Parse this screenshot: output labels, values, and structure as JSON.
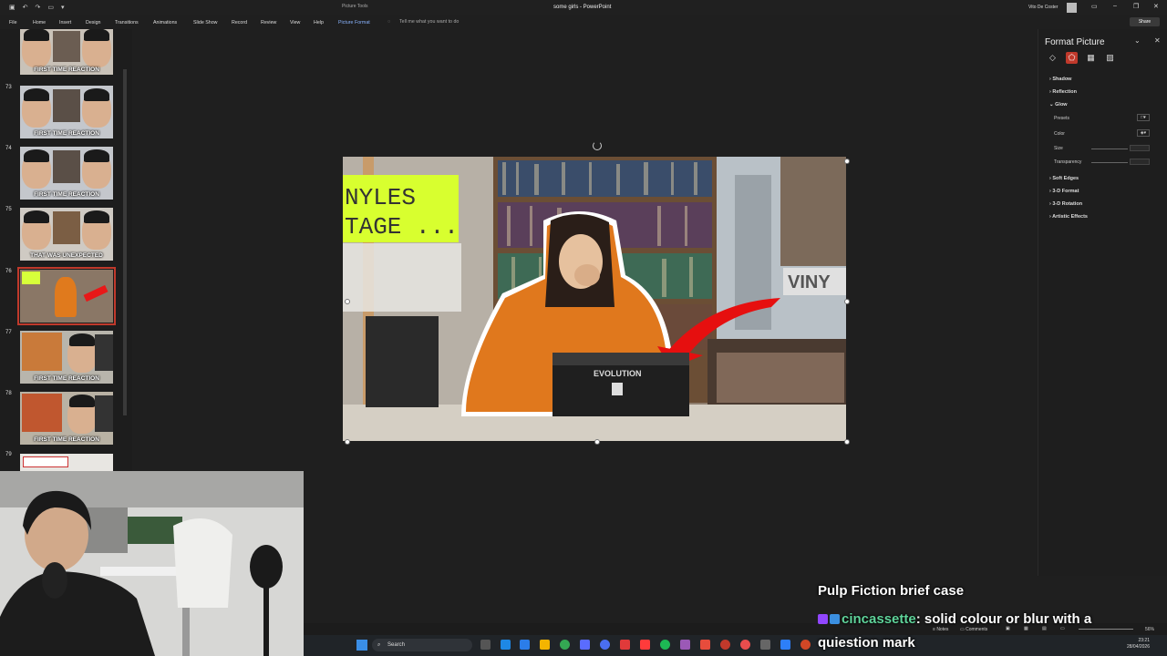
{
  "titlebar": {
    "context_label": "Picture Tools",
    "document_title": "some girls - PowerPoint",
    "user_name": "Vito De Coster"
  },
  "ribbon": {
    "tabs": [
      "File",
      "Home",
      "Insert",
      "Design",
      "Transitions",
      "Animations",
      "Slide Show",
      "Record",
      "Review",
      "View",
      "Help",
      "Picture Format"
    ],
    "tell_me": "Tell me what you want to do",
    "share": "Share"
  },
  "slides": [
    {
      "num": "",
      "caption": "FIRST TIME REACTION"
    },
    {
      "num": "73",
      "caption": "FIRST TIME REACTION"
    },
    {
      "num": "74",
      "caption": "FIRST TIME REACTION"
    },
    {
      "num": "75",
      "caption": "THAT WAS UNEXPECTED"
    },
    {
      "num": "76",
      "caption": ""
    },
    {
      "num": "77",
      "caption": "FIRST TIME REACTION"
    },
    {
      "num": "78",
      "caption": "FIRST TIME REACTION"
    },
    {
      "num": "79",
      "caption": ""
    }
  ],
  "slide_image": {
    "sign_line1": "NYLES",
    "sign_line2": "TAGE ...",
    "store_sign": "VINY",
    "case_label": "EVOLUTION"
  },
  "format_pane": {
    "title": "Format Picture",
    "sections": {
      "shadow": "Shadow",
      "reflection": "Reflection",
      "glow": "Glow",
      "presets": "Presets",
      "color": "Color",
      "size": "Size",
      "transparency": "Transparency",
      "soft_edges": "Soft Edges",
      "format_3d": "3-D Format",
      "rotation_3d": "3-D Rotation",
      "artistic": "Artistic Effects"
    }
  },
  "status": {
    "notes": "Notes",
    "comments": "Comments",
    "zoom": "56%"
  },
  "taskbar": {
    "search": "Search",
    "time": "23:21",
    "date": "28/04/2026"
  },
  "chat": {
    "line1": "Pulp Fiction brief case",
    "username": "cincassette",
    "message": ": solid colour or blur with a quiestion mark"
  }
}
